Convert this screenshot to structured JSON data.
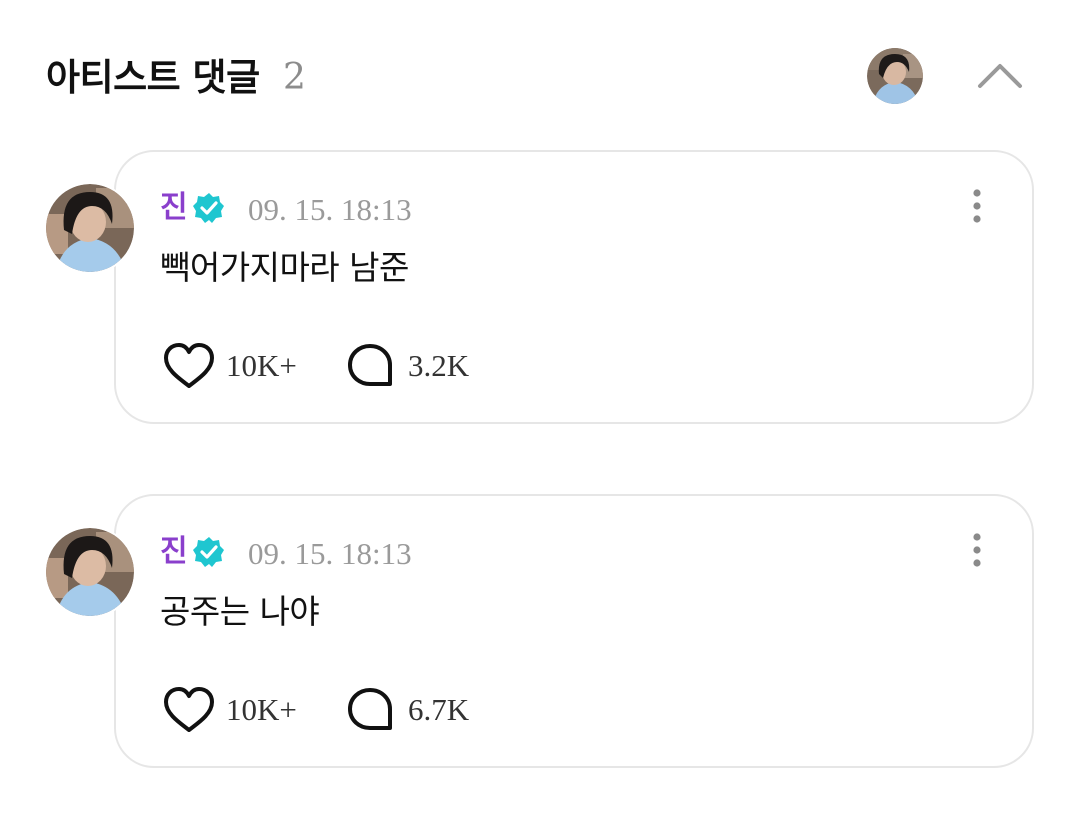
{
  "header": {
    "title": "아티스트 댓글",
    "count": "2",
    "avatar_icon": "artist-avatar",
    "collapse_icon": "chevron-up-icon"
  },
  "colors": {
    "author": "#8a3fcc",
    "verified": "#1fc6d0",
    "timestamp": "#9a9a9a",
    "card_border": "#e6e6e6"
  },
  "comments": [
    {
      "author": "진",
      "verified": true,
      "timestamp": "09. 15. 18:13",
      "text": "빽어가지마라 남준",
      "likes": "10K+",
      "replies": "3.2K"
    },
    {
      "author": "진",
      "verified": true,
      "timestamp": "09. 15. 18:13",
      "text": "공주는 나야",
      "likes": "10K+",
      "replies": "6.7K"
    }
  ]
}
